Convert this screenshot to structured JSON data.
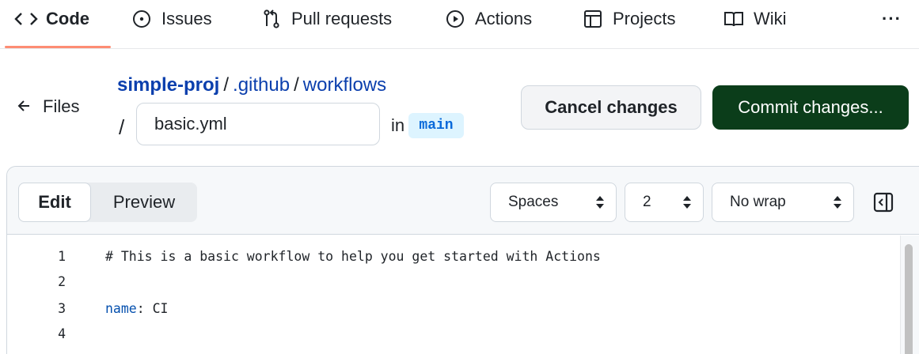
{
  "nav": {
    "items": [
      {
        "label": "Code",
        "icon": "code-icon",
        "active": true
      },
      {
        "label": "Issues",
        "icon": "issue-circle-icon",
        "active": false
      },
      {
        "label": "Pull requests",
        "icon": "pull-request-icon",
        "active": false
      },
      {
        "label": "Actions",
        "icon": "play-circle-icon",
        "active": false
      },
      {
        "label": "Projects",
        "icon": "table-icon",
        "active": false
      },
      {
        "label": "Wiki",
        "icon": "book-icon",
        "active": false
      }
    ],
    "more_label": "···",
    "active_underline_color": "#fd8c73"
  },
  "header": {
    "back_label": "Files",
    "breadcrumb": {
      "repo": "simple-proj",
      "sep": "/",
      "dir1": ".github",
      "dir2": "workflows"
    },
    "path_sep": "/",
    "filename_value": "basic.yml",
    "in_label": "in",
    "branch": "main",
    "cancel_label": "Cancel changes",
    "commit_label": "Commit changes...",
    "commit_color": "#0b3d1a"
  },
  "editor": {
    "tabs": {
      "edit": "Edit",
      "preview": "Preview"
    },
    "indent_mode": "Spaces",
    "indent_size": "2",
    "wrap_mode": "No wrap",
    "lines": [
      {
        "num": "1",
        "text": "# This is a basic workflow to help you get started with Actions"
      },
      {
        "num": "2",
        "text": ""
      },
      {
        "num": "3",
        "key": "name",
        "rest": ": CI"
      },
      {
        "num": "4",
        "text": ""
      }
    ]
  }
}
